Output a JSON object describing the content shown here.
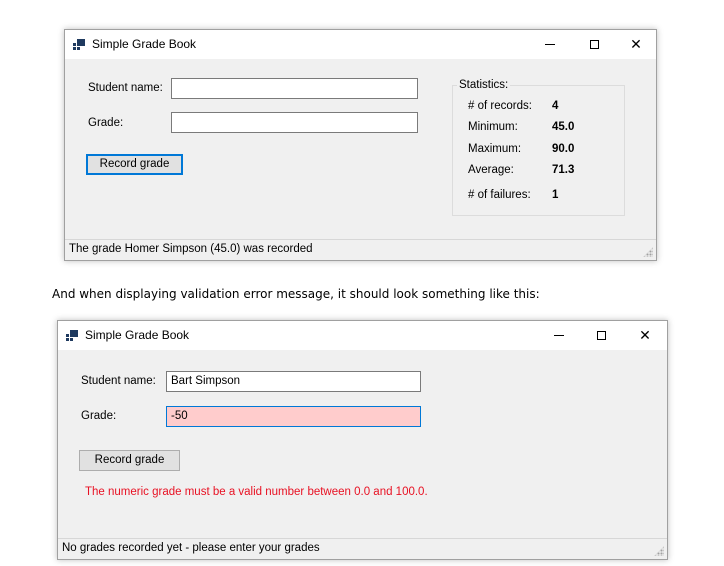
{
  "window1": {
    "title": "Simple Grade Book",
    "student_name_label": "Student name:",
    "student_name_value": "",
    "grade_label": "Grade:",
    "grade_value": "",
    "record_button": "Record grade",
    "statistics": {
      "title": "Statistics:",
      "rows": [
        {
          "label": "# of records:",
          "value": "4"
        },
        {
          "label": "Minimum:",
          "value": "45.0"
        },
        {
          "label": "Maximum:",
          "value": "90.0"
        },
        {
          "label": "Average:",
          "value": "71.3"
        },
        {
          "label": "# of failures:",
          "value": "1"
        }
      ]
    },
    "status": "The grade Homer Simpson (45.0) was recorded"
  },
  "between_text": "And when displaying validation error message, it should look something like this:",
  "window2": {
    "title": "Simple Grade Book",
    "student_name_label": "Student name:",
    "student_name_value": "Bart Simpson",
    "grade_label": "Grade:",
    "grade_value": "-50",
    "record_button": "Record grade",
    "error_message": "The numeric grade must be a valid number between 0.0 and 100.0.",
    "status": "No grades recorded yet - please enter your grades"
  },
  "colors": {
    "error_text": "#e81123",
    "error_field_bg": "#ffcccc",
    "focus_border": "#0078d7",
    "window_bg": "#f0f0f0"
  },
  "icons": [
    "app-icon",
    "minimize-icon",
    "maximize-icon",
    "close-icon",
    "size-grip-icon"
  ]
}
